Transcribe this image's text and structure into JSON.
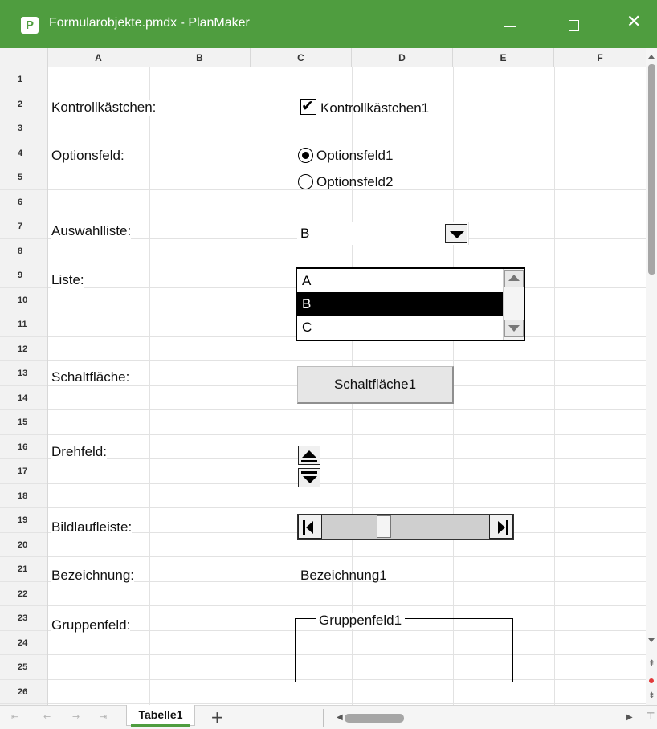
{
  "window": {
    "app_icon_letter": "P",
    "title": "Formularobjekte.pmdx - PlanMaker",
    "minimize_glyph": "—",
    "close_glyph": "✕",
    "accent_color": "#4f9d3f"
  },
  "columns": [
    "A",
    "B",
    "C",
    "D",
    "E",
    "F"
  ],
  "rows": [
    "1",
    "2",
    "3",
    "4",
    "5",
    "6",
    "7",
    "8",
    "9",
    "10",
    "11",
    "12",
    "13",
    "14",
    "15",
    "16",
    "17",
    "18",
    "19",
    "20",
    "21",
    "22",
    "23",
    "24",
    "25",
    "26"
  ],
  "labels": {
    "checkbox": "Kontrollkästchen:",
    "option": "Optionsfeld:",
    "combo": "Auswahlliste:",
    "list": "Liste:",
    "button": "Schaltfläche:",
    "spin": "Drehfeld:",
    "scrollbar": "Bildlaufleiste:",
    "label": "Bezeichnung:",
    "group": "Gruppenfeld:"
  },
  "controls": {
    "checkbox": {
      "label": "Kontrollkästchen1",
      "checked": true,
      "check_glyph": "✔"
    },
    "option1": {
      "label": "Optionsfeld1",
      "selected": true
    },
    "option2": {
      "label": "Optionsfeld2",
      "selected": false
    },
    "combo": {
      "value": "B"
    },
    "list": {
      "items": [
        "A",
        "B",
        "C"
      ],
      "selected": "B"
    },
    "button": {
      "label": "Schaltfläche1"
    },
    "scrollbar": {
      "position_fraction": 0.36
    },
    "static_label": {
      "text": "Bezeichnung1"
    },
    "groupbox": {
      "title": "Gruppenfeld1"
    }
  },
  "sheetbar": {
    "nav_first": "⇤",
    "nav_prev": "←",
    "nav_next": "→",
    "nav_last": "⇥",
    "active_tab": "Tabelle1",
    "add_glyph": "+",
    "scroll_left_glyph": "◀",
    "scroll_right_glyph": "▶"
  }
}
